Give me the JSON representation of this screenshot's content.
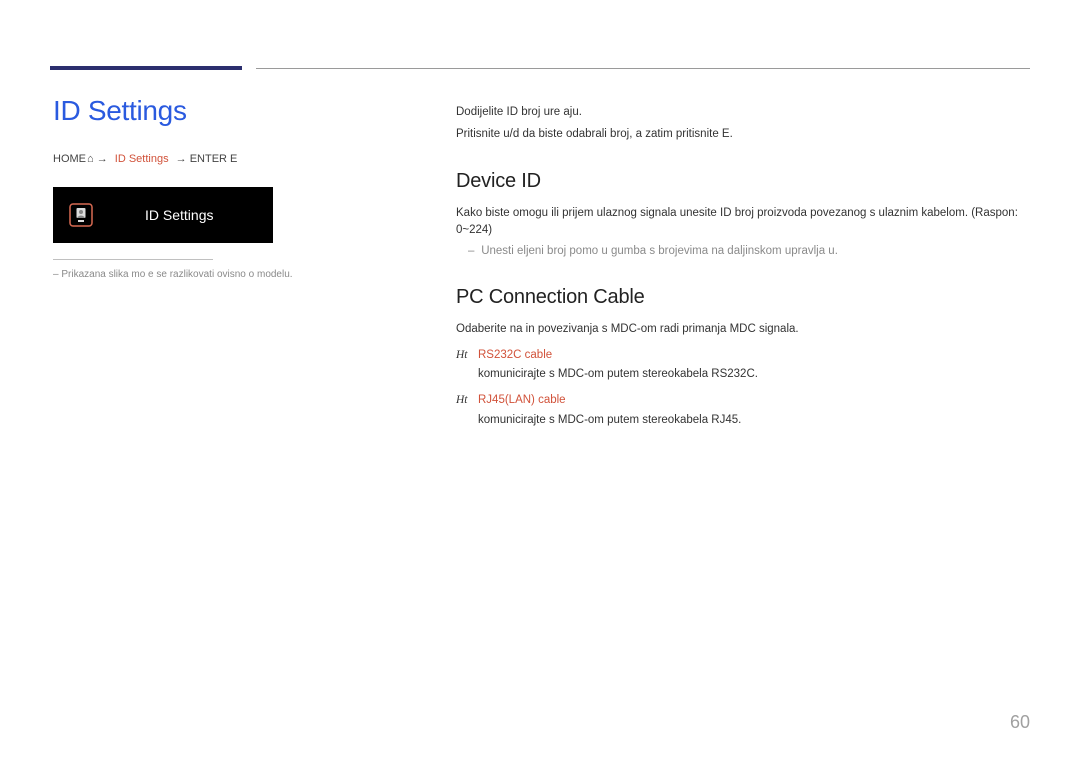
{
  "page": {
    "number": "60"
  },
  "left": {
    "title": "ID Settings",
    "breadcrumb": {
      "home": "HOME",
      "home_icon_name": "home-icon",
      "sep": ":",
      "current": "ID Settings",
      "enter": "ENTER E"
    },
    "menu": {
      "icon_name": "id-settings-icon",
      "label": "ID Settings"
    },
    "footnote_marker": "–",
    "footnote": "Prikazana slika mo e se razlikovati ovisno o modelu."
  },
  "right": {
    "intro1": "Dodijelite ID broj ure aju.",
    "intro2": "Pritisnite u/d da biste odabrali broj, a zatim pritisnite E.",
    "device_id": {
      "title": "Device ID",
      "p1": "Kako biste omogu ili prijem ulaznog signala unesite ID broj proizvoda povezanog s ulaznim kabelom. (Raspon: 0~224)",
      "p2": "Unesti  eljeni broj pomo u gumba s brojevima na daljinskom upravlja u."
    },
    "pc_cable": {
      "title": "PC Connection Cable",
      "p1": "Odaberite na in povezivanja s MDC-om radi primanja MDC signala.",
      "options": [
        {
          "bullet": "Ht",
          "name": "RS232C cable",
          "desc": "komunicirajte s MDC-om putem stereokabela RS232C."
        },
        {
          "bullet": "Ht",
          "name": "RJ45(LAN) cable",
          "desc": "komunicirajte s MDC-om putem stereokabela RJ45."
        }
      ]
    }
  }
}
